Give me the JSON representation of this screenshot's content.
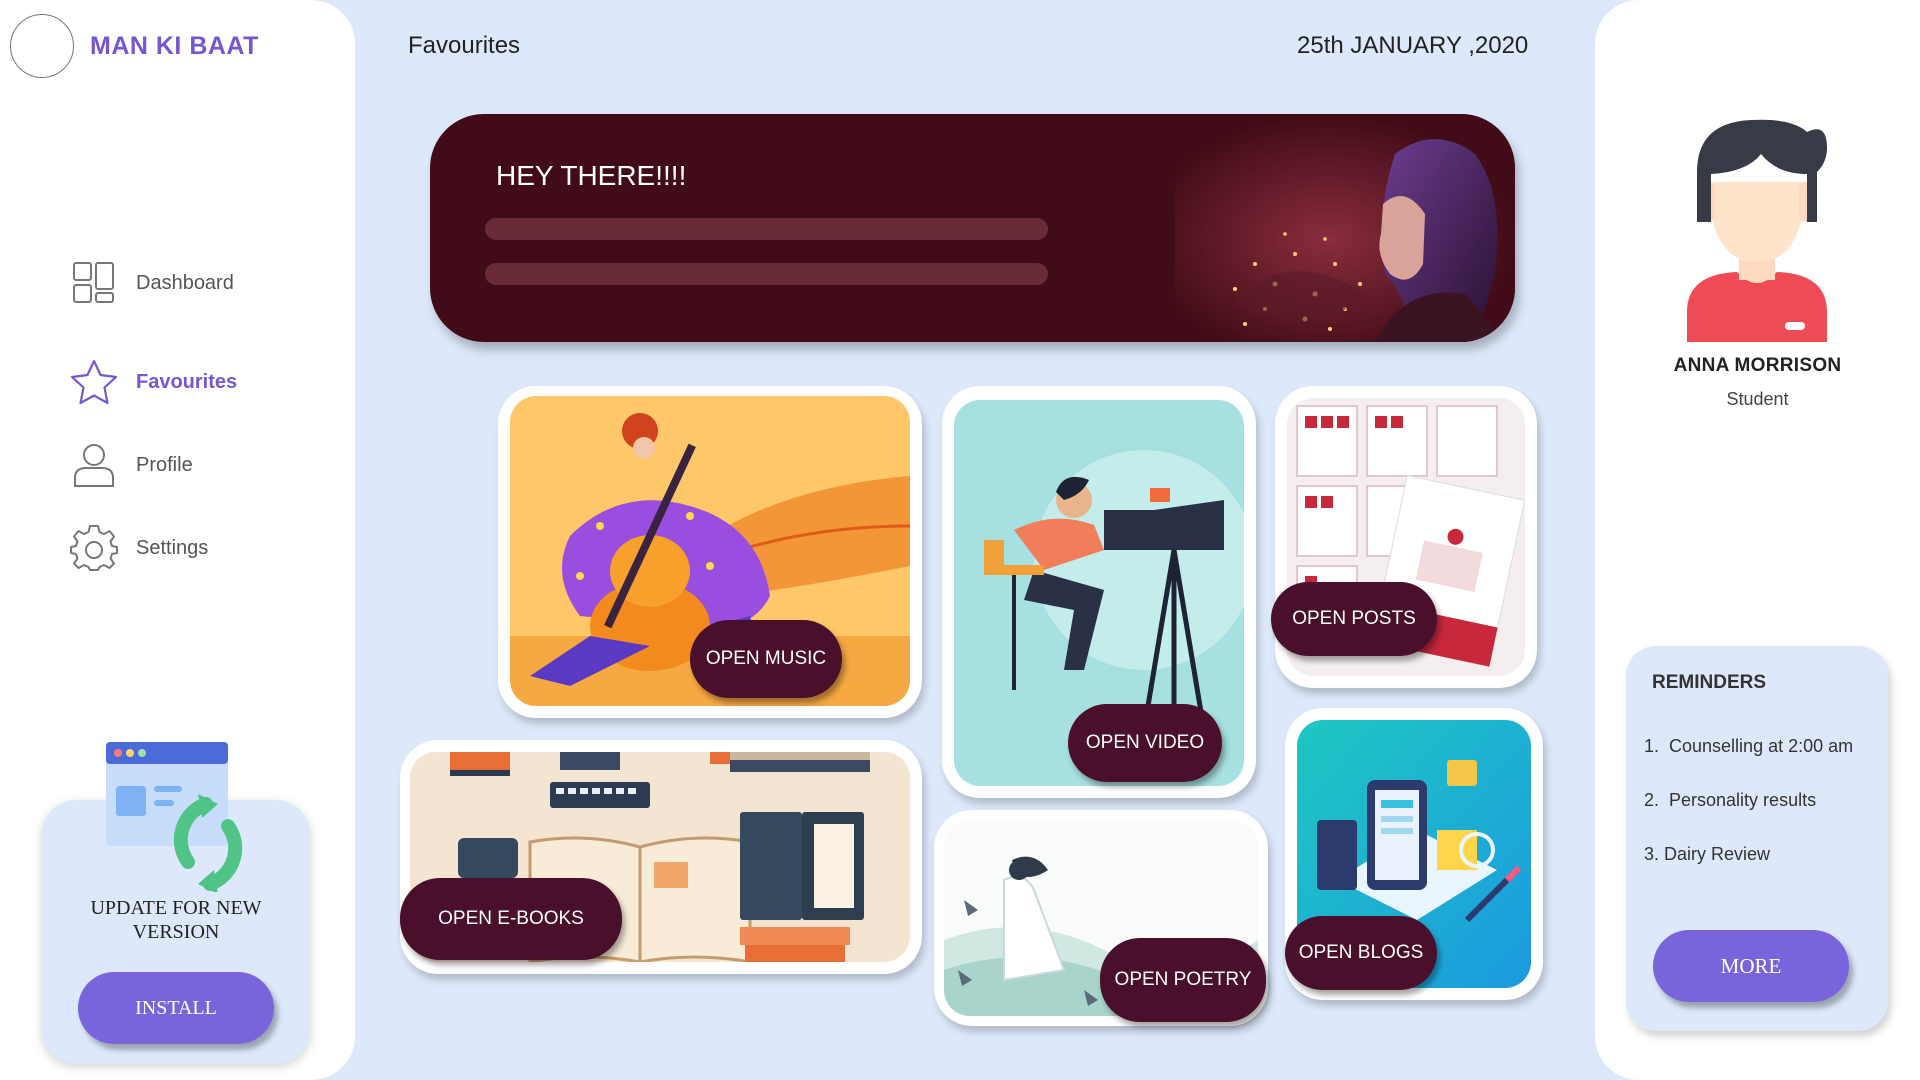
{
  "brand": {
    "name": "MAN KI BAAT"
  },
  "nav": {
    "items": [
      {
        "label": "Dashboard",
        "icon": "dashboard-icon",
        "active": false
      },
      {
        "label": "Favourites",
        "icon": "star-icon",
        "active": true
      },
      {
        "label": "Profile",
        "icon": "user-icon",
        "active": false
      },
      {
        "label": "Settings",
        "icon": "gear-icon",
        "active": false
      }
    ]
  },
  "update": {
    "text": "UPDATE FOR NEW VERSION",
    "button_label": "INSTALL"
  },
  "header": {
    "title": "Favourites",
    "date": "25th JANUARY ,2020"
  },
  "banner": {
    "greeting": "HEY THERE!!!!"
  },
  "cards": {
    "music": "OPEN MUSIC",
    "video": "OPEN VIDEO",
    "posts": "OPEN POSTS",
    "ebooks": "OPEN E-BOOKS",
    "poetry": "OPEN POETRY",
    "blogs": "OPEN BLOGS"
  },
  "user": {
    "name": "ANNA MORRISON",
    "role": "Student"
  },
  "reminders": {
    "title": "REMINDERS",
    "items": [
      "Counselling at 2:00 am",
      "Personality results",
      "Dairy Review"
    ],
    "more_label": "MORE"
  },
  "colors": {
    "accent": "#7757d1",
    "button": "#7a64dc",
    "banner": "#410c17",
    "card_button": "#4a0f2a",
    "background": "#dde9fb"
  }
}
